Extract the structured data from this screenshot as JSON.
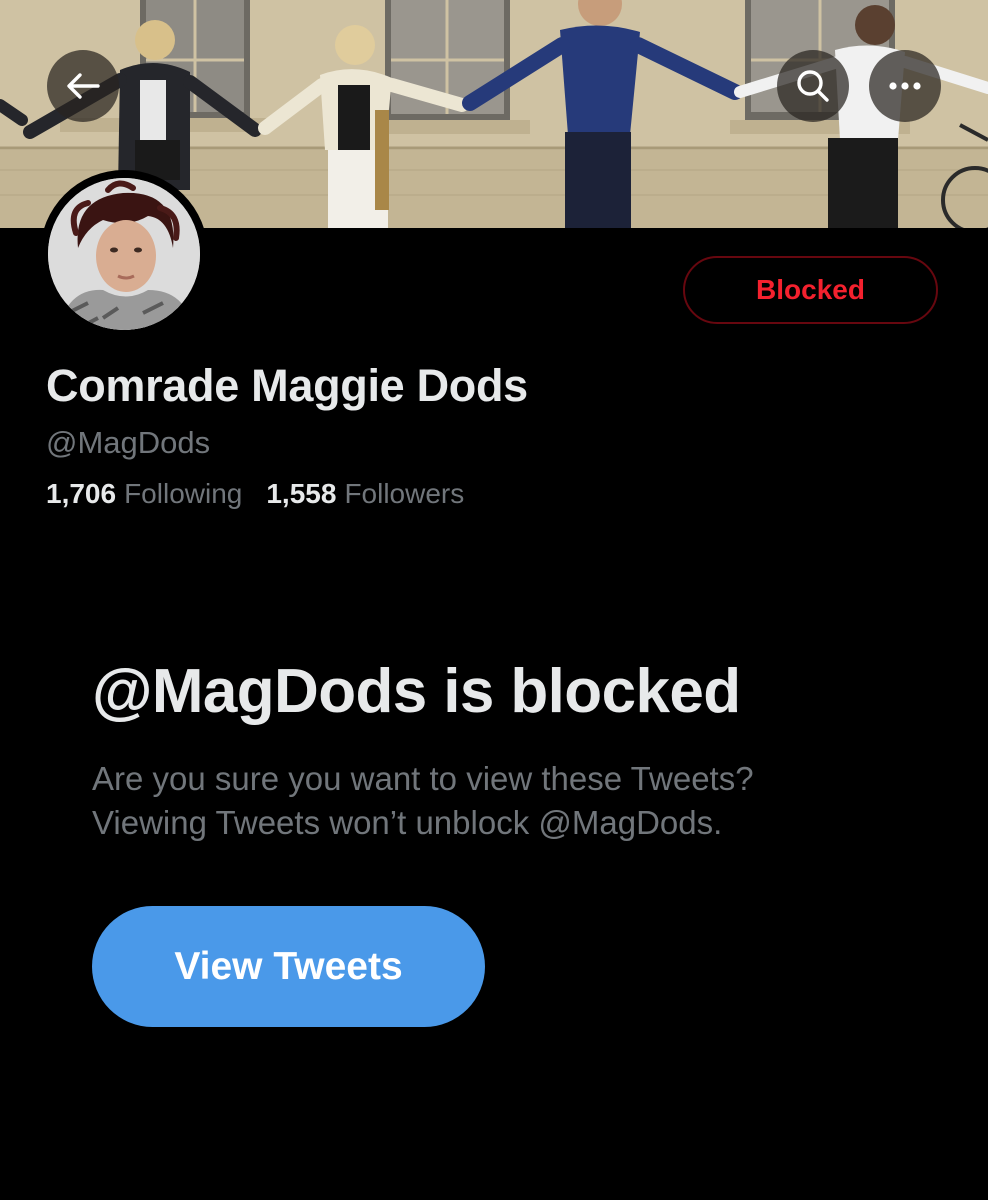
{
  "header": {
    "back_icon": "arrow-left-icon",
    "search_icon": "search-icon",
    "more_icon": "more-horizontal-icon"
  },
  "profile": {
    "display_name": "Comrade Maggie Dods",
    "handle": "@MagDods",
    "following_count": "1,706",
    "following_label": "Following",
    "followers_count": "1,558",
    "followers_label": "Followers",
    "blocked_button_label": "Blocked"
  },
  "blocked_notice": {
    "title": "@MagDods is blocked",
    "line1": "Are you sure you want to view these Tweets?",
    "line2": "Viewing Tweets won’t unblock @MagDods.",
    "button_label": "View Tweets"
  },
  "colors": {
    "background": "#000000",
    "primary_text": "#e7e9ea",
    "secondary_text": "#71767b",
    "blocked_red": "#f4212e",
    "button_blue": "#4a99e9"
  }
}
